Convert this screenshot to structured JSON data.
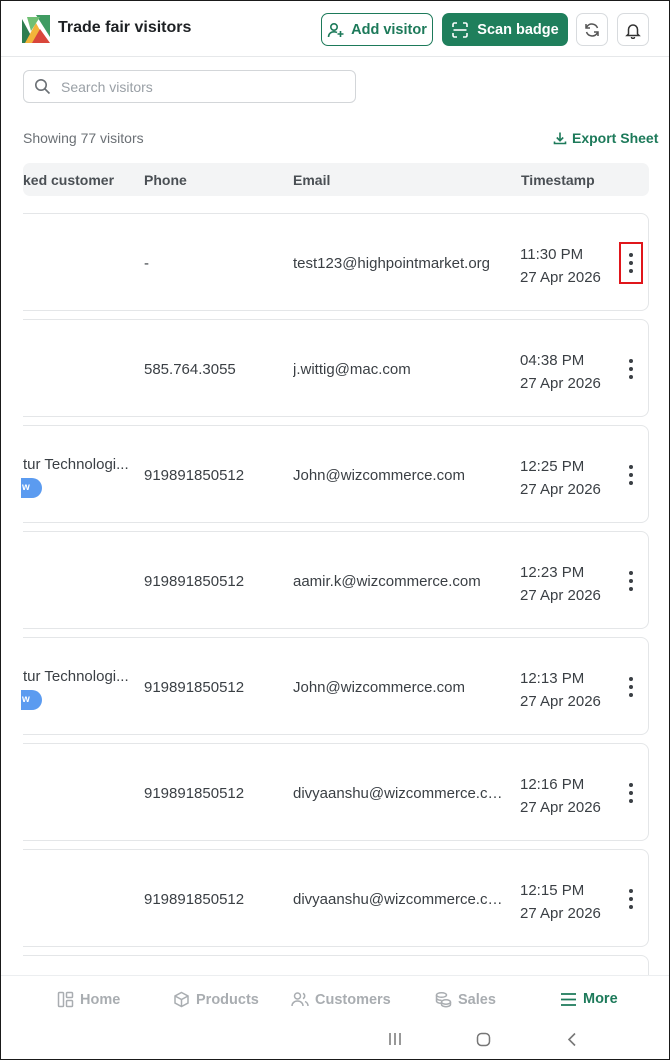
{
  "header": {
    "title": "Trade fair visitors",
    "add_visitor_label": "Add visitor",
    "scan_badge_label": "Scan badge"
  },
  "search": {
    "placeholder": "Search visitors"
  },
  "summary": {
    "count_text": "Showing 77 visitors",
    "export_label": "Export Sheet"
  },
  "table": {
    "columns": [
      "ked customer",
      "Phone",
      "Email",
      "Timestamp"
    ],
    "rows": [
      {
        "customer": "",
        "tag": "",
        "phone": "-",
        "email": "test123@highpointmarket.org",
        "time": "11:30 PM",
        "date": "27 Apr 2026"
      },
      {
        "customer": "",
        "tag": "",
        "phone": "585.764.3055",
        "email": "j.wittig@mac.com",
        "time": "04:38 PM",
        "date": "27 Apr 2026"
      },
      {
        "customer": "tur Technologi...",
        "tag": "w",
        "phone": "919891850512",
        "email": "John@wizcommerce.com",
        "time": "12:25 PM",
        "date": "27 Apr 2026"
      },
      {
        "customer": "",
        "tag": "",
        "phone": "919891850512",
        "email": "aamir.k@wizcommerce.com",
        "time": "12:23 PM",
        "date": "27 Apr 2026"
      },
      {
        "customer": "tur Technologi...",
        "tag": "w",
        "phone": "919891850512",
        "email": "John@wizcommerce.com",
        "time": "12:13 PM",
        "date": "27 Apr 2026"
      },
      {
        "customer": "",
        "tag": "",
        "phone": "919891850512",
        "email": "divyaanshu@wizcommerce.co...",
        "time": "12:16 PM",
        "date": "27 Apr 2026"
      },
      {
        "customer": "",
        "tag": "",
        "phone": "919891850512",
        "email": "divyaanshu@wizcommerce.co...",
        "time": "12:15 PM",
        "date": "27 Apr 2026"
      }
    ]
  },
  "nav": {
    "items": [
      {
        "label": "Home",
        "icon": "home-icon"
      },
      {
        "label": "Products",
        "icon": "box-icon"
      },
      {
        "label": "Customers",
        "icon": "users-icon"
      },
      {
        "label": "Sales",
        "icon": "coins-icon"
      },
      {
        "label": "More",
        "icon": "menu-icon",
        "active": true
      }
    ]
  },
  "colors": {
    "brand": "#1f7f5c",
    "highlight": "#e0161b",
    "tag": "#5b9bf0"
  }
}
